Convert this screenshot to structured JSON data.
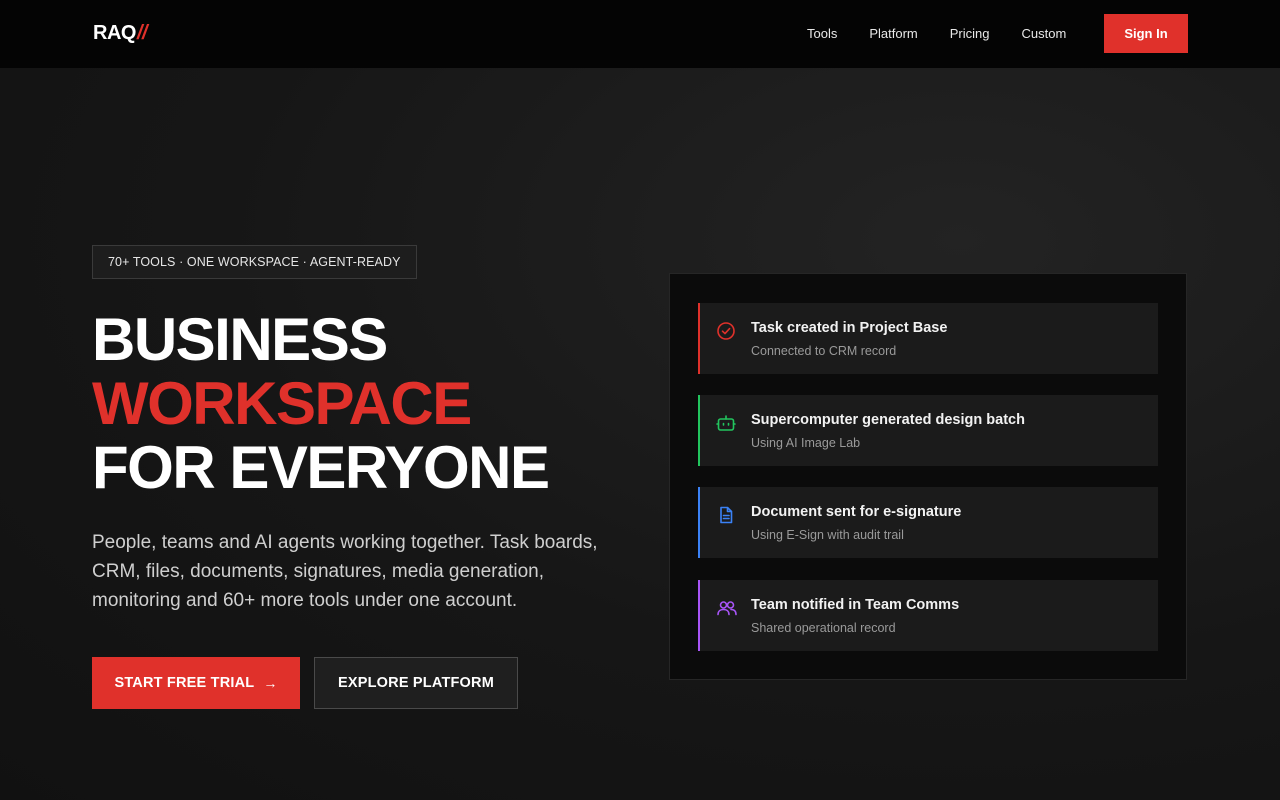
{
  "nav": {
    "logo_text": "RAQ",
    "logo_accent": "//",
    "links": [
      "Tools",
      "Platform",
      "Pricing",
      "Custom"
    ],
    "signin_label": "Sign In"
  },
  "hero": {
    "badge": "70+ TOOLS · ONE WORKSPACE · AGENT-READY",
    "title_line1": "BUSINESS",
    "title_line2": "WORKSPACE",
    "title_line3": "FOR EVERYONE",
    "description": "People, teams and AI agents working together. Task boards, CRM, files, documents, signatures, media generation, monitoring and 60+ more tools under one account.",
    "primary_label": "START FREE TRIAL",
    "primary_arrow": "→",
    "secondary_label": "EXPLORE PLATFORM"
  },
  "activity": [
    {
      "title": "Task created in Project Base",
      "subtitle": "Connected to CRM record",
      "icon": "check-circle-icon",
      "color": "#e0312b"
    },
    {
      "title": "Supercomputer generated design batch",
      "subtitle": "Using AI Image Lab",
      "icon": "robot-icon",
      "color": "#22c55e"
    },
    {
      "title": "Document sent for e-signature",
      "subtitle": "Using E-Sign with audit trail",
      "icon": "document-icon",
      "color": "#3b82f6"
    },
    {
      "title": "Team notified in Team Comms",
      "subtitle": "Shared operational record",
      "icon": "users-icon",
      "color": "#a855f7"
    }
  ],
  "colors": {
    "accent": "#e0312b",
    "background": "#151515",
    "navbar": "#040404"
  }
}
